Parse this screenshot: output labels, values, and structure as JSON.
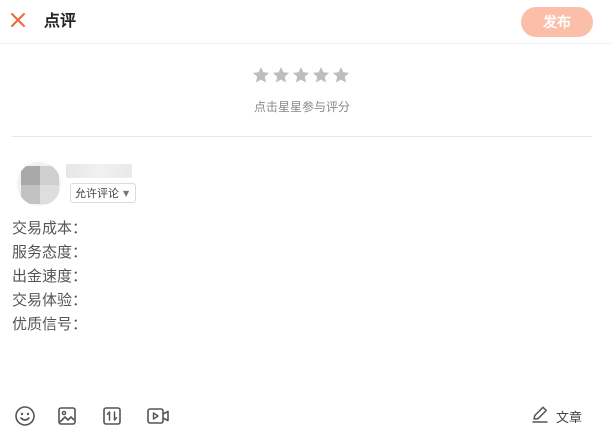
{
  "header": {
    "title": "点评",
    "publish_label": "发布",
    "close_icon": "close-icon",
    "accent_color": "#f0673c",
    "publish_bg": "#fbbfa9"
  },
  "rating": {
    "star_count": 5,
    "selected": 0,
    "hint": "点击星星参与评分",
    "star_color": "#bdbdbd"
  },
  "user": {
    "comment_permission": "允许评论"
  },
  "template_lines": [
    "交易成本：",
    "服务态度：",
    "出金速度：",
    "交易体验：",
    "优质信号："
  ],
  "toolbar": {
    "emoji_icon": "emoji-icon",
    "image_icon": "image-icon",
    "sort_icon": "sort-icon",
    "video_icon": "video-icon",
    "article_label": "文章",
    "article_icon": "edit-icon"
  }
}
